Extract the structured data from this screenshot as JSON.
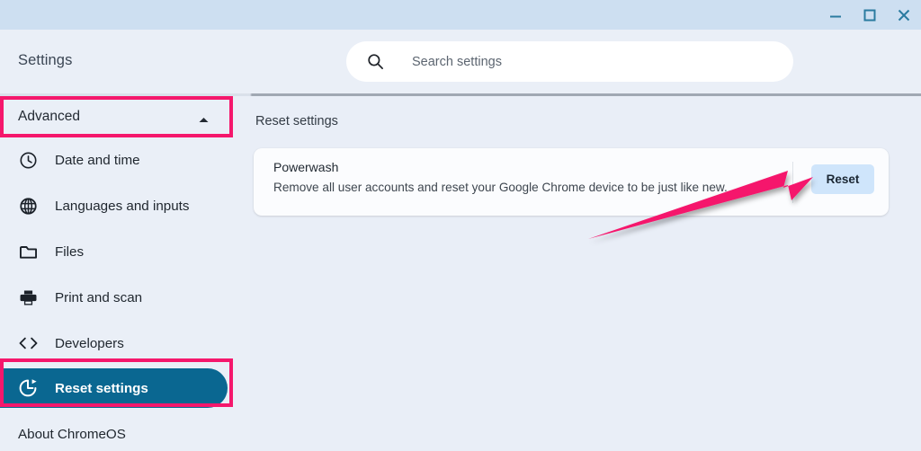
{
  "window": {
    "controls": [
      {
        "name": "minimize",
        "label": "Minimize"
      },
      {
        "name": "maximize",
        "label": "Maximize"
      },
      {
        "name": "close",
        "label": "Close"
      }
    ],
    "titlebar_color": "#cddff1"
  },
  "header": {
    "app_title": "Settings",
    "search": {
      "placeholder": "Search settings",
      "value": "",
      "icon": "search-icon"
    }
  },
  "sidebar": {
    "advanced": {
      "label": "Advanced",
      "expanded": true,
      "chevron_icon": "chevron-up-icon"
    },
    "items": [
      {
        "label": "Date and time",
        "icon": "clock-icon",
        "selected": false
      },
      {
        "label": "Languages and inputs",
        "icon": "globe-icon",
        "selected": false
      },
      {
        "label": "Files",
        "icon": "folder-icon",
        "selected": false
      },
      {
        "label": "Print and scan",
        "icon": "printer-icon",
        "selected": false
      },
      {
        "label": "Developers",
        "icon": "code-brackets-icon",
        "selected": false
      },
      {
        "label": "Reset settings",
        "icon": "restore-icon",
        "selected": true
      }
    ],
    "about": "About ChromeOS",
    "selected_color": "#0a6791"
  },
  "main": {
    "section_title": "Reset settings",
    "card": {
      "title": "Powerwash",
      "description": "Remove all user accounts and reset your Google Chrome device to be just like new.",
      "button_label": "Reset",
      "button_color": "#cfe5fb"
    }
  },
  "annotations": {
    "highlight_color": "#f5176c",
    "boxes": [
      {
        "target": "Advanced"
      },
      {
        "target": "Reset settings"
      }
    ],
    "arrow": {
      "points_to": "Reset"
    }
  }
}
